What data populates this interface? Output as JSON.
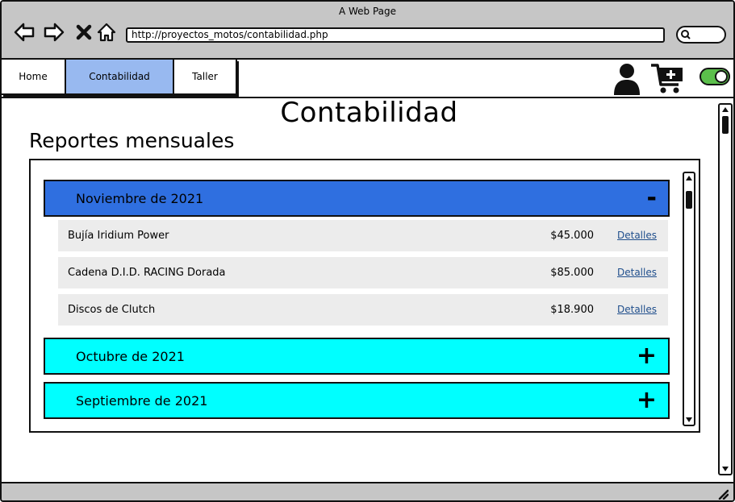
{
  "window": {
    "title": "A Web Page"
  },
  "browser": {
    "url": "http://proyectos_motos/contabilidad.php",
    "icons": [
      "back-arrow-icon",
      "forward-arrow-icon",
      "close-x-icon",
      "home-icon",
      "search-icon"
    ]
  },
  "nav": {
    "tabs": [
      {
        "label": "Home",
        "active": false
      },
      {
        "label": "Contabilidad",
        "active": true
      },
      {
        "label": "Taller",
        "active": false
      }
    ],
    "active_color": "#98b9f0",
    "icons": [
      "user-icon",
      "cart-add-icon",
      "toggle-switch"
    ]
  },
  "page": {
    "title": "Contabilidad",
    "section_title": "Reportes mensuales"
  },
  "accordion": [
    {
      "month": "Noviembre de 2021",
      "sign": "-",
      "expanded": true,
      "color": "#2f6fe0",
      "items": [
        {
          "name": "Bujía Iridium Power",
          "price": "$45.000",
          "link": "Detalles"
        },
        {
          "name": "Cadena D.I.D. RACING Dorada",
          "price": "$85.000",
          "link": "Detalles"
        },
        {
          "name": "Discos de Clutch",
          "price": "$18.900",
          "link": "Detalles"
        }
      ]
    },
    {
      "month": "Octubre de 2021",
      "sign": "+",
      "expanded": false,
      "color": "#00ffff"
    },
    {
      "month": "Septiembre de 2021",
      "sign": "+",
      "expanded": false,
      "color": "#00ffff"
    }
  ]
}
